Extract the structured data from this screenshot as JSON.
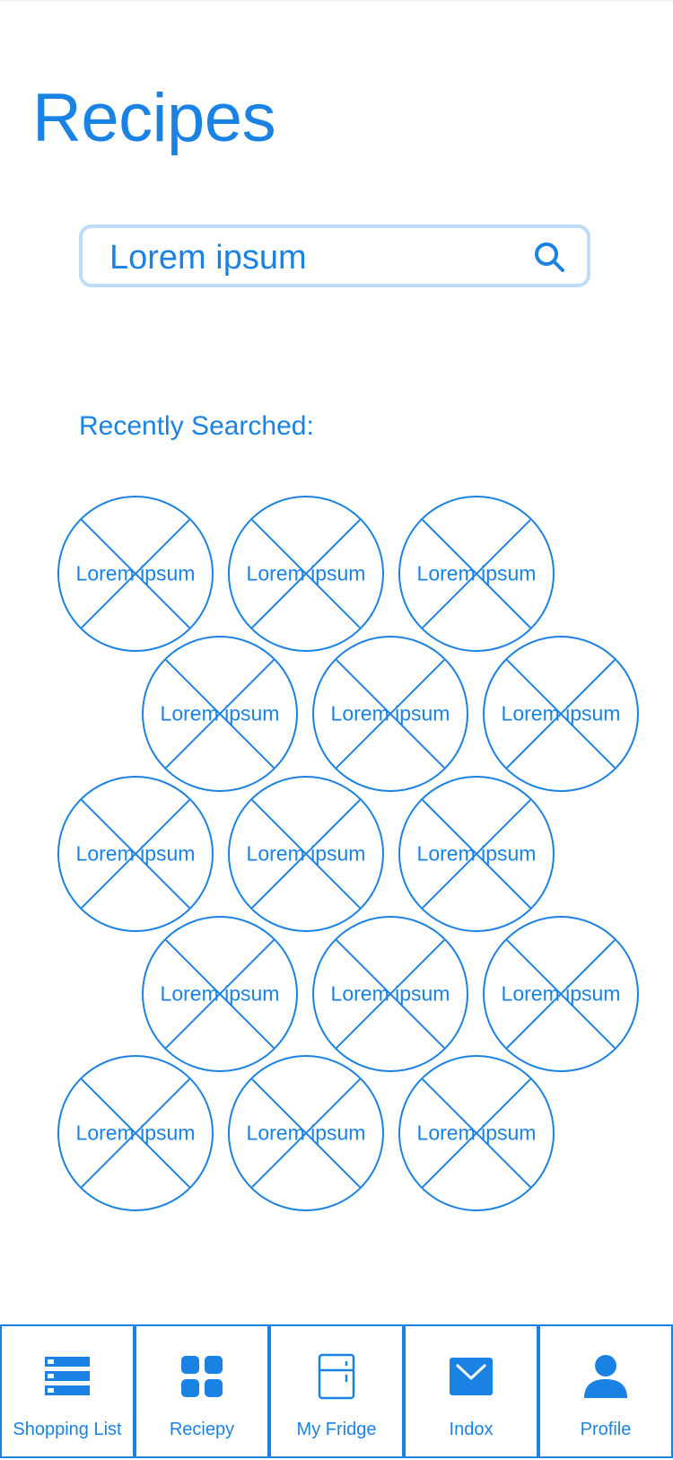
{
  "header": {
    "title": "Recipes"
  },
  "search": {
    "value": "Lorem ipsum"
  },
  "recent": {
    "label": "Recently Searched:",
    "items": [
      "Lorem ipsum",
      "Lorem ipsum",
      "Lorem ipsum",
      "Lorem ipsum",
      "Lorem ipsum",
      "Lorem ipsum",
      "Lorem ipsum",
      "Lorem ipsum",
      "Lorem ipsum",
      "Lorem ipsum",
      "Lorem ipsum",
      "Lorem ipsum",
      "Lorem ipsum",
      "Lorem ipsum",
      "Lorem ipsum"
    ]
  },
  "tabbar": {
    "tabs": [
      {
        "label": "Shopping List",
        "icon": "list-icon"
      },
      {
        "label": "Reciepy",
        "icon": "grid-icon"
      },
      {
        "label": "My Fridge",
        "icon": "fridge-icon"
      },
      {
        "label": "Indox",
        "icon": "mail-icon"
      },
      {
        "label": "Profile",
        "icon": "person-icon"
      }
    ]
  },
  "colors": {
    "accent": "#1a82e2",
    "search_border": "#bcdcf7"
  }
}
